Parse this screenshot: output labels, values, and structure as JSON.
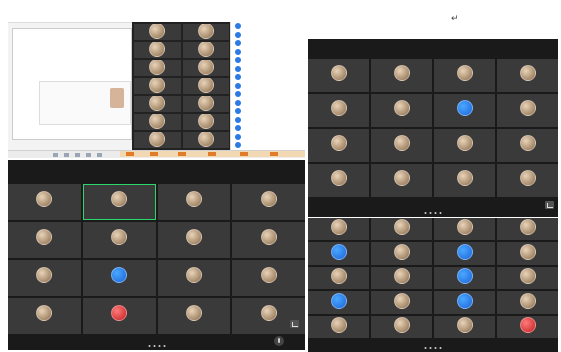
{
  "page": {
    "return_mark": "↵"
  },
  "panel_a": {
    "title_label": "",
    "slide_text": [
      "",
      "",
      ""
    ],
    "video_tiles": 14,
    "list_items": 15,
    "join_button": ""
  },
  "panel_b": {
    "rows": 4,
    "cols": 4,
    "tiles": [
      {
        "name": "",
        "avatar": "photo"
      },
      {
        "name": "",
        "avatar": "photo"
      },
      {
        "name": "",
        "avatar": "photo"
      },
      {
        "name": "",
        "avatar": "photo"
      },
      {
        "name": "",
        "avatar": "photo"
      },
      {
        "name": "",
        "avatar": "photo"
      },
      {
        "name": "",
        "avatar": "blue"
      },
      {
        "name": "",
        "avatar": "photo"
      },
      {
        "name": "",
        "avatar": "photo"
      },
      {
        "name": "",
        "avatar": "photo"
      },
      {
        "name": "",
        "avatar": "photo"
      },
      {
        "name": "",
        "avatar": "photo"
      },
      {
        "name": "",
        "avatar": "photo"
      },
      {
        "name": "",
        "avatar": "photo"
      },
      {
        "name": "",
        "avatar": "photo"
      },
      {
        "name": "",
        "avatar": "photo"
      }
    ]
  },
  "panel_c": {
    "rows": 4,
    "cols": 4,
    "tiles": [
      {
        "name": "",
        "avatar": "photo"
      },
      {
        "name": "",
        "avatar": "photo",
        "highlight": true
      },
      {
        "name": "",
        "avatar": "photo"
      },
      {
        "name": "",
        "avatar": "photo"
      },
      {
        "name": "",
        "avatar": "photo"
      },
      {
        "name": "",
        "avatar": "photo"
      },
      {
        "name": "",
        "avatar": "photo"
      },
      {
        "name": "",
        "avatar": "photo"
      },
      {
        "name": "",
        "avatar": "photo"
      },
      {
        "name": "",
        "avatar": "blue"
      },
      {
        "name": "",
        "avatar": "photo"
      },
      {
        "name": "",
        "avatar": "photo"
      },
      {
        "name": "",
        "avatar": "photo"
      },
      {
        "name": "",
        "avatar": "red"
      },
      {
        "name": "",
        "avatar": "photo"
      },
      {
        "name": "",
        "avatar": "photo"
      }
    ]
  },
  "panel_d": {
    "rows": 5,
    "cols": 4,
    "tiles": [
      {
        "name": "",
        "avatar": "photo"
      },
      {
        "name": "",
        "avatar": "photo"
      },
      {
        "name": "",
        "avatar": "photo"
      },
      {
        "name": "",
        "avatar": "photo"
      },
      {
        "name": "",
        "avatar": "blue"
      },
      {
        "name": "",
        "avatar": "photo"
      },
      {
        "name": "",
        "avatar": "blue"
      },
      {
        "name": "",
        "avatar": "photo"
      },
      {
        "name": "",
        "avatar": "photo"
      },
      {
        "name": "",
        "avatar": "photo"
      },
      {
        "name": "",
        "avatar": "blue"
      },
      {
        "name": "",
        "avatar": "photo"
      },
      {
        "name": "",
        "avatar": "blue"
      },
      {
        "name": "",
        "avatar": "photo"
      },
      {
        "name": "",
        "avatar": "blue"
      },
      {
        "name": "",
        "avatar": "photo"
      },
      {
        "name": "",
        "avatar": "photo"
      },
      {
        "name": "",
        "avatar": "photo"
      },
      {
        "name": "",
        "avatar": "photo"
      },
      {
        "name": "",
        "avatar": "red"
      }
    ]
  }
}
